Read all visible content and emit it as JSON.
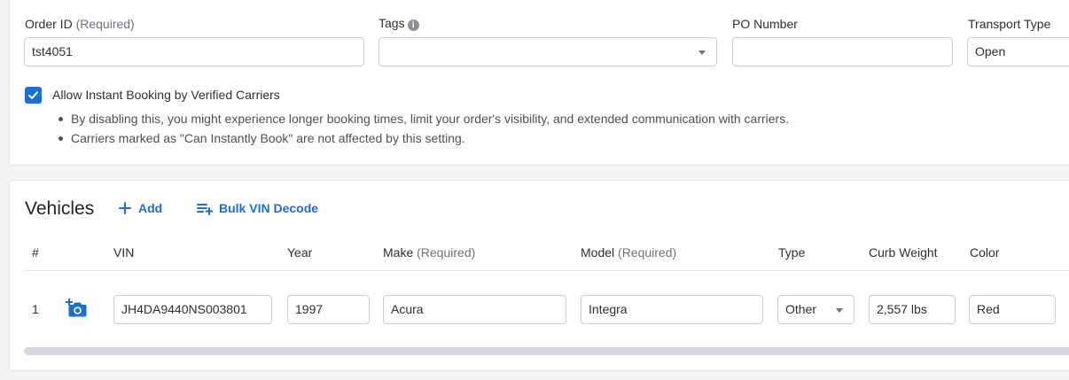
{
  "order": {
    "order_id_label": "Order ID",
    "order_id_required": "(Required)",
    "order_id_value": "tst4051",
    "tags_label": "Tags",
    "tags_info_icon": "info-icon",
    "tags_value": "",
    "po_label": "PO Number",
    "po_value": "",
    "transport_label": "Transport Type",
    "transport_value": "Open",
    "instant_booking": {
      "label": "Allow Instant Booking by Verified Carriers",
      "checked": true,
      "notes": [
        "By disabling this, you might experience longer booking times, limit your order's visibility, and extended communication with carriers.",
        "Carriers marked as \"Can Instantly Book\" are not affected by this setting."
      ]
    }
  },
  "vehicles": {
    "title": "Vehicles",
    "add_label": "Add",
    "bulk_label": "Bulk VIN Decode",
    "accent": "#1a6fd6",
    "columns": {
      "num": "#",
      "vin": "VIN",
      "year": "Year",
      "make": "Make",
      "make_required": "(Required)",
      "model": "Model",
      "model_required": "(Required)",
      "type": "Type",
      "curb_weight": "Curb Weight",
      "color": "Color"
    },
    "rows": [
      {
        "num": "1",
        "photo_icon": "add-photo-icon",
        "vin": "JH4DA9440NS003801",
        "year": "1997",
        "make": "Acura",
        "model": "Integra",
        "type": "Other",
        "curb_weight": "2,557 lbs",
        "color": "Red"
      }
    ]
  }
}
